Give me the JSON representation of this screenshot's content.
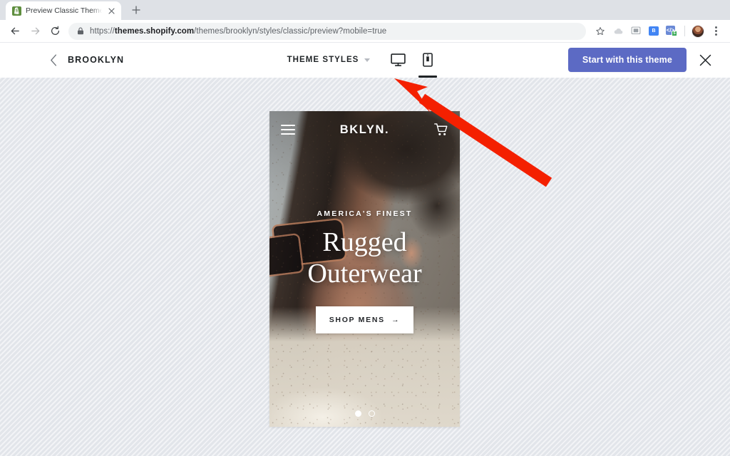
{
  "browser": {
    "tab": {
      "title": "Preview Classic Theme - Brook",
      "favicon": "shopify-bag-icon",
      "close": "×"
    },
    "new_tab_label": "+",
    "nav": {
      "back": "back-arrow-icon",
      "forward": "forward-arrow-icon",
      "reload": "reload-icon"
    },
    "omnibox": {
      "lock": "lock-icon",
      "scheme": "https://",
      "domain": "themes.shopify.com",
      "path": "/themes/brooklyn/styles/classic/preview?mobile=true"
    },
    "toolbar_icons": {
      "bookmark": "star-icon",
      "cloud": "cloud-icon",
      "cast": "cast-icon",
      "ext_one_label": "B",
      "ext_two_label": "</>",
      "ext_two_badge": "S",
      "profile": "avatar",
      "menu": "kebab-menu-icon"
    }
  },
  "preview_bar": {
    "back_label": "back-chevron-icon",
    "theme_name": "BROOKLYN",
    "theme_styles_label": "THEME STYLES",
    "views": [
      {
        "name": "desktop",
        "icon": "desktop-monitor-icon",
        "active": false
      },
      {
        "name": "mobile",
        "icon": "mobile-phone-icon",
        "active": true
      }
    ],
    "cta_label": "Start with this theme",
    "cta_color": "#5c6ac4",
    "close_label": "close-icon"
  },
  "phone_preview": {
    "store_logo": "BKLYN.",
    "menu_icon": "hamburger-menu-icon",
    "cart_icon": "shopping-cart-icon",
    "hero": {
      "eyebrow": "AMERICA'S FINEST",
      "headline_line1": "Rugged",
      "headline_line2": "Outerwear",
      "button_label": "SHOP MENS",
      "button_arrow": "→"
    },
    "carousel": {
      "slides": 2,
      "active_index": 0
    }
  },
  "annotation": {
    "arrow_color": "#f42000",
    "points_to": "mobile-view-tab"
  }
}
